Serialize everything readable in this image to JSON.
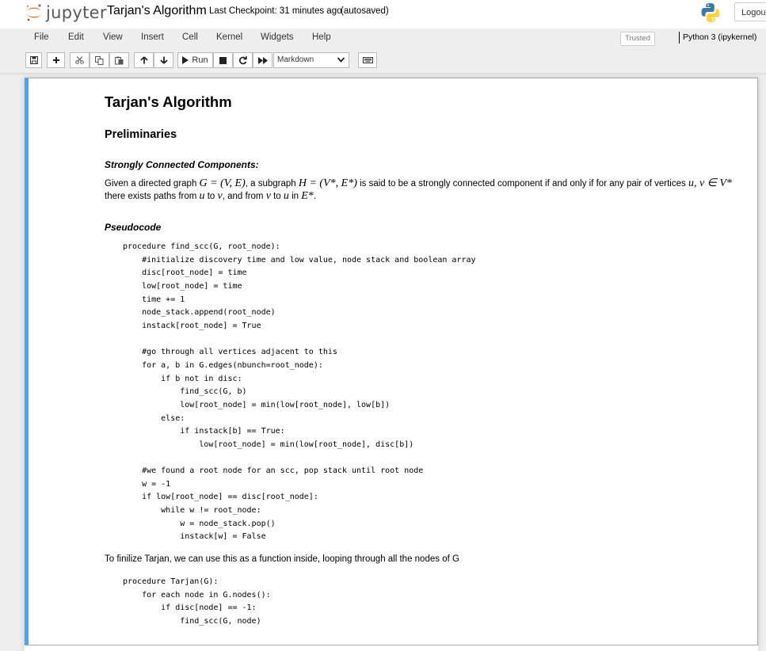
{
  "header": {
    "logo_text": "jupyter",
    "notebook_name": "Tarjan's Algorithm",
    "checkpoint": "Last Checkpoint: 31 minutes ago",
    "autosave": "(autosaved)",
    "logout_label": "Logout",
    "logo_icon": "jupyter-logo-icon",
    "python_icon": "python-logo-icon"
  },
  "menubar": {
    "items": [
      "File",
      "Edit",
      "View",
      "Insert",
      "Cell",
      "Kernel",
      "Widgets",
      "Help"
    ],
    "trusted": "Trusted",
    "kernel": "Python 3 (ipykernel)",
    "kernel_indicator": "◯"
  },
  "toolbar": {
    "run_label": "Run",
    "cell_type": "Markdown",
    "icons": [
      "save-icon",
      "plus-icon",
      "cut-icon",
      "copy-icon",
      "paste-icon",
      "arrow-up-icon",
      "arrow-down-icon",
      "run-icon",
      "stop-icon",
      "restart-icon",
      "fast-forward-icon",
      "keyboard-icon"
    ]
  },
  "colors": {
    "cell_border_selected": "#42a5f5",
    "background": "#eeeeee"
  },
  "cell": {
    "title": "Tarjan's Algorithm",
    "section": "Preliminaries",
    "scc_heading": "Strongly Connected Components:",
    "def_a": "Given a directed graph ",
    "def_m1": "G = (V, E)",
    "def_b": ", a subgraph ",
    "def_m2": "H = (V*, E*)",
    "def_c": " is said to be a strongly connected component if and only if for any pair of vertices ",
    "def_m3": "u, v ∈ V*",
    "def2_a": "there exists paths from ",
    "def2_m1": "u",
    "def2_b": " to ",
    "def2_m2": "v",
    "def2_c": ", and from ",
    "def2_m3": "v",
    "def2_d": " to ",
    "def2_m4": "u",
    "def2_e": " in ",
    "def2_m5": "E*",
    "def2_f": ".",
    "pseudocode_heading": "Pseudocode",
    "code1": "procedure find_scc(G, root_node):\n    #initialize discovery time and low value, node stack and boolean array\n    disc[root_node] = time\n    low[root_node] = time\n    time += 1\n    node_stack.append(root_node)\n    instack[root_node] = True\n\n    #go through all vertices adjacent to this\n    for a, b in G.edges(nbunch=root_node):\n        if b not in disc:\n            find_scc(G, b)\n            low[root_node] = min(low[root_node], low[b])\n        else:\n            if instack[b] == True:\n                low[root_node] = min(low[root_node], disc[b])\n\n    #we found a root node for an scc, pop stack until root node\n    w = -1\n    if low[root_node] == disc[root_node]:\n        while w != root_node:\n            w = node_stack.pop()\n            instack[w] = False",
    "finalize_text": "To finilize Tarjan, we can use this as a function inside, looping through all the nodes of G",
    "code2": "procedure Tarjan(G):\n    for each node in G.nodes():\n        if disc[node] == -1:\n            find_scc(G, node)"
  }
}
